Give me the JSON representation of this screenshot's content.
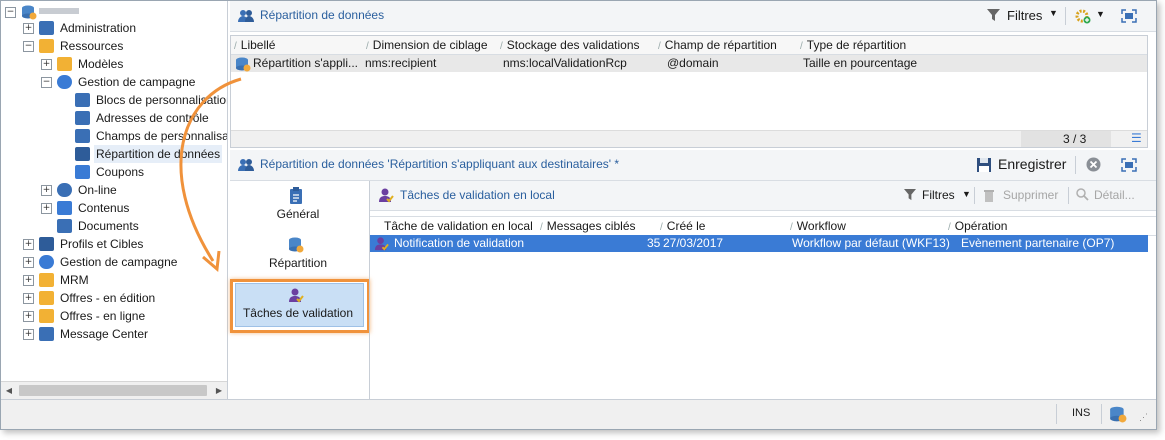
{
  "colors": {
    "accent": "#2a5f9e",
    "selection": "#3a7bd5",
    "highlight": "#f0923b"
  },
  "tree": {
    "items": [
      {
        "label": "Administration",
        "icon": "gear-icon"
      },
      {
        "label": "Ressources",
        "icon": "folder-resources-icon"
      },
      {
        "label": "Modèles",
        "icon": "folder-icon"
      },
      {
        "label": "Gestion de campagne",
        "icon": "campaign-icon"
      },
      {
        "label": "Blocs de personnalisation",
        "icon": "list-icon"
      },
      {
        "label": "Adresses de contrôle",
        "icon": "mail-check-icon"
      },
      {
        "label": "Champs de personnalisation",
        "icon": "mail-fields-icon"
      },
      {
        "label": "Répartition de données",
        "icon": "users-icon"
      },
      {
        "label": "Coupons",
        "icon": "coupon-icon"
      },
      {
        "label": "On-line",
        "icon": "globe-icon"
      },
      {
        "label": "Contenus",
        "icon": "content-icon"
      },
      {
        "label": "Documents",
        "icon": "document-icon"
      },
      {
        "label": "Profils et Cibles",
        "icon": "users-icon"
      },
      {
        "label": "Gestion de campagne",
        "icon": "campaign-icon"
      },
      {
        "label": "MRM",
        "icon": "mrm-icon"
      },
      {
        "label": "Offres - en édition",
        "icon": "offer-icon"
      },
      {
        "label": "Offres - en ligne",
        "icon": "offer-icon"
      },
      {
        "label": "Message Center",
        "icon": "message-center-icon"
      }
    ]
  },
  "top": {
    "title": "Répartition de données",
    "filters_label": "Filtres",
    "columns": [
      "Libellé",
      "Dimension de ciblage",
      "Stockage des validations",
      "Champ de répartition",
      "Type de répartition"
    ],
    "rows": [
      [
        "Répartition s'appli...",
        "nms:recipient",
        "nms:localValidationRcp",
        "@domain",
        "Taille en pourcentage"
      ]
    ],
    "count": "3 / 3"
  },
  "detail": {
    "title": "Répartition de données 'Répartition s'appliquant aux destinataires' *",
    "save_label": "Enregistrer",
    "tabs": [
      {
        "label": "Général"
      },
      {
        "label": "Répartition"
      },
      {
        "label": "Tâches de validation"
      }
    ],
    "sub": {
      "title": "Tâches de validation en local",
      "filters_label": "Filtres",
      "delete_label": "Supprimer",
      "detail_label": "Détail...",
      "columns": [
        "Tâche de validation en local",
        "Messages ciblés",
        "Créé le",
        "Workflow",
        "Opération"
      ],
      "rows": [
        [
          "Notification de validation",
          "35",
          "27/03/2017",
          "Workflow par défaut (WKF13)",
          "Evènement partenaire (OP7)"
        ]
      ]
    }
  },
  "status": {
    "ins": "INS"
  }
}
